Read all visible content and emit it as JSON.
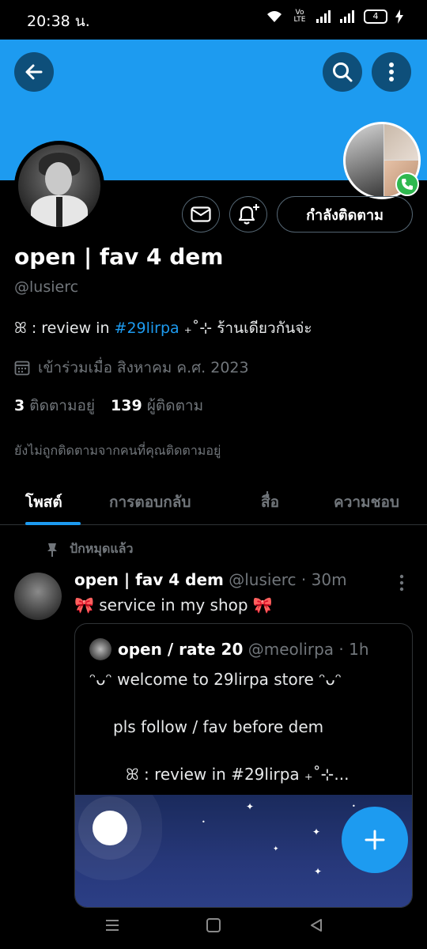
{
  "status_bar": {
    "time": "20:38 น.",
    "battery": "4",
    "network_label": "Vo LTE"
  },
  "profile": {
    "display_name": "open | fav 4 dem",
    "handle": "@lusierc",
    "bio_prefix": "ꕤ : review in ",
    "bio_hashtag": "#29lirpa",
    "bio_suffix": " ₊˚⊹ ร้านเดียวกันจ่ะ",
    "joined": "เข้าร่วมเมื่อ สิงหาคม ค.ศ. 2023",
    "following_count": "3",
    "following_label": "ติดตามอยู่",
    "followers_count": "139",
    "followers_label": "ผู้ติดตาม",
    "not_followed_note": "ยังไม่ถูกติดตามจากคนที่คุณติดตามอยู่",
    "follow_button": "กำลังติดตาม"
  },
  "tabs": [
    {
      "label": "โพสต์",
      "active": true
    },
    {
      "label": "การตอบกลับ",
      "active": false
    },
    {
      "label": "สื่อ",
      "active": false
    },
    {
      "label": "ความชอบ",
      "active": false
    }
  ],
  "pinned_label": "ปักหมุดแล้ว",
  "post": {
    "author": "open | fav 4 dem",
    "handle": "@lusierc",
    "time": "· 30m",
    "text": "🎀 service in my shop 🎀",
    "quote": {
      "author": "open / rate 20",
      "handle": "@meolirpa",
      "time": "· 1h",
      "line1": "ᵔᴗᵔ welcome to 29lirpa store ᵔᴗᵔ",
      "line2": "pls follow / fav before dem",
      "line3": "ꕤ  : review in #29lirpa ₊˚⊹..."
    }
  },
  "icons": {
    "back": "back-arrow-icon",
    "search": "search-icon",
    "more": "more-vertical-icon",
    "message": "mail-icon",
    "notify": "bell-plus-icon",
    "calendar": "calendar-icon",
    "pin": "pin-icon",
    "compose": "plus-icon"
  },
  "colors": {
    "accent": "#1d9bf0",
    "banner": "#1d9bf0",
    "background": "#000000",
    "muted": "#71767b"
  }
}
